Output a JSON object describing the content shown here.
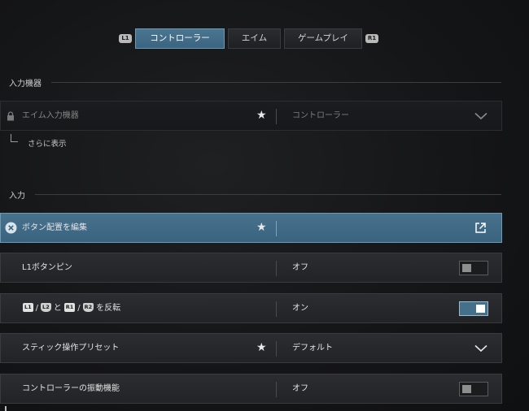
{
  "tabs": {
    "left_bumper": "L1",
    "right_bumper": "R1",
    "items": [
      {
        "label": "コントローラー",
        "active": true
      },
      {
        "label": "エイム",
        "active": false
      },
      {
        "label": "ゲームプレイ",
        "active": false
      }
    ]
  },
  "sections": {
    "input_device": {
      "title": "入力機器",
      "rows": [
        {
          "name": "エイム入力機器",
          "value": "コントローラー",
          "locked": true,
          "favorite": true,
          "control": "dropdown"
        }
      ],
      "show_more": "さらに表示"
    },
    "input": {
      "title": "入力",
      "rows": [
        {
          "name": "ボタン配置を編集",
          "favorite": true,
          "control": "external-link",
          "selected": true
        },
        {
          "name": "L1ボタンピン",
          "value": "オフ",
          "control": "toggle",
          "state": "off"
        },
        {
          "name_parts": {
            "b1": "L1",
            "s1": "/",
            "b2": "L2",
            "mid": "と",
            "b3": "R1",
            "s2": "/",
            "b4": "R2",
            "suffix": "を反転"
          },
          "value": "オン",
          "control": "toggle",
          "state": "on"
        },
        {
          "name": "スティック操作プリセット",
          "value": "デフォルト",
          "favorite": true,
          "control": "dropdown"
        },
        {
          "name": "コントローラーの振動機能",
          "value": "オフ",
          "control": "toggle",
          "state": "off"
        }
      ]
    }
  },
  "icons": {
    "favorite": "star-icon",
    "lock": "lock-icon",
    "clear": "clear-icon",
    "dropdown": "chevron-down-icon",
    "external": "external-link-icon"
  },
  "colors": {
    "accent": "#44708c",
    "accent_border": "#6e98b3",
    "row_bg": "#27282b",
    "background": "#141517"
  }
}
